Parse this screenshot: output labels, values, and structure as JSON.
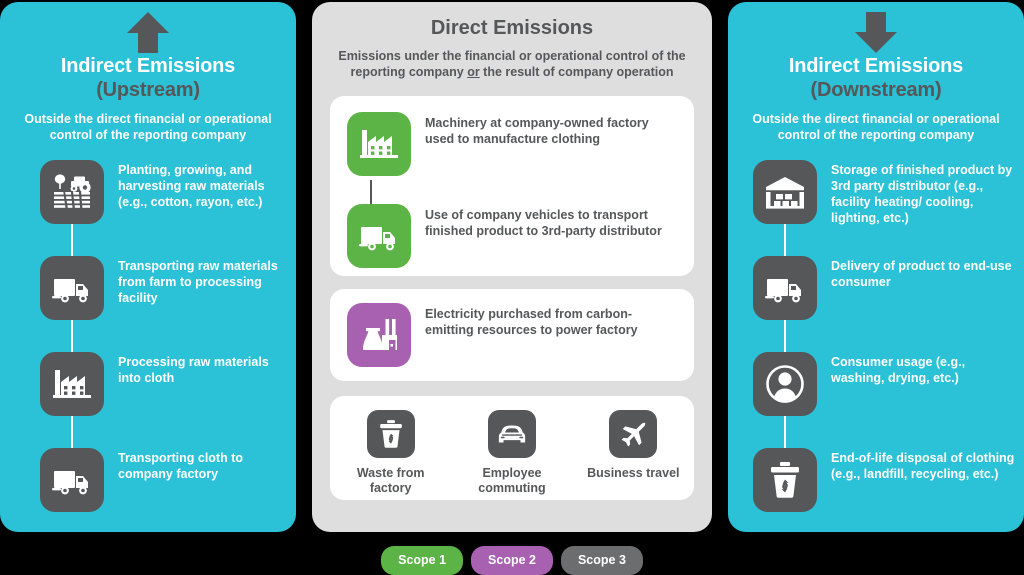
{
  "colors": {
    "cyan_panel": "#2bc1d6",
    "gray_panel": "#dededf",
    "dark_gray": "#555759",
    "scope1_green": "#5cb446",
    "scope2_purple": "#a860b0",
    "scope3_gray": "#6b6d6f",
    "card_white": "#ffffff"
  },
  "upstream": {
    "arrow_icon": "arrow-up-icon",
    "title": "Indirect Emissions",
    "title_paren": "(Upstream)",
    "subtitle": "Outside the direct financial or operational control of the reporting company",
    "items": [
      {
        "icon": "farm-tractor-icon",
        "text": "Planting, growing, and harvesting raw materials (e.g., cotton, rayon, etc.)"
      },
      {
        "icon": "truck-icon",
        "text": "Transporting raw materials from farm to processing facility"
      },
      {
        "icon": "factory-icon",
        "text": "Processing raw materials into cloth"
      },
      {
        "icon": "truck-icon",
        "text": "Transporting cloth to company factory"
      }
    ]
  },
  "direct": {
    "title": "Direct Emissions",
    "subtitle_before": "Emissions under the financial or operational control of the reporting company ",
    "subtitle_underlined": "or",
    "subtitle_after": " the result of company operation",
    "scope1_items": [
      {
        "icon": "factory-icon",
        "text": "Machinery at company-owned factory used to manufacture clothing"
      },
      {
        "icon": "truck-icon",
        "text": "Use of company vehicles to transport finished product to 3rd-party distributor"
      }
    ],
    "scope2_items": [
      {
        "icon": "power-plant-icon",
        "text": "Electricity purchased from carbon-emitting resources to power factory"
      }
    ],
    "scope3_items": [
      {
        "icon": "recycle-bin-icon",
        "text": "Waste from factory"
      },
      {
        "icon": "car-icon",
        "text": "Employee commuting"
      },
      {
        "icon": "airplane-icon",
        "text": "Business travel"
      }
    ]
  },
  "downstream": {
    "arrow_icon": "arrow-down-icon",
    "title": "Indirect Emissions",
    "title_paren": "(Downstream)",
    "subtitle": "Outside the direct financial or operational control of the reporting company",
    "items": [
      {
        "icon": "warehouse-icon",
        "text": "Storage of finished product by 3rd party distributor (e.g., facility heating/ cooling, lighting, etc.)"
      },
      {
        "icon": "truck-icon",
        "text": "Delivery of product to end-use consumer"
      },
      {
        "icon": "person-icon",
        "text": "Consumer usage (e.g., washing, drying, etc.)"
      },
      {
        "icon": "recycle-bin-icon",
        "text": "End-of-life disposal of clothing (e.g., landfill, recycling, etc.)"
      }
    ]
  },
  "legend": {
    "items": [
      {
        "label": "Scope 1",
        "color": "#5cb446"
      },
      {
        "label": "Scope 2",
        "color": "#a860b0"
      },
      {
        "label": "Scope 3",
        "color": "#6b6d6f"
      }
    ]
  }
}
